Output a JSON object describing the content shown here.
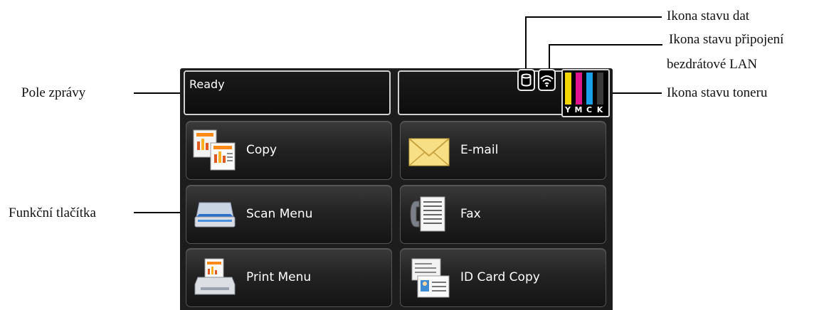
{
  "callouts": {
    "data_status_icon": "Ikona stavu dat",
    "wlan_status_icon_line1": "Ikona stavu připojení",
    "wlan_status_icon_line2": "bezdrátové LAN",
    "toner_status_icon": "Ikona stavu toneru",
    "message_field": "Pole zprávy",
    "function_buttons": "Funkční tlačítka"
  },
  "screen": {
    "message": "Ready",
    "toner": {
      "labels": [
        "Y",
        "M",
        "C",
        "K"
      ],
      "colors": [
        "#f2d400",
        "#e0148c",
        "#1aa0e8",
        "#2a2a2a"
      ]
    },
    "buttons": [
      {
        "label": "Copy",
        "icon": "copy-icon"
      },
      {
        "label": "E-mail",
        "icon": "envelope-icon"
      },
      {
        "label": "Scan Menu",
        "icon": "scanner-icon"
      },
      {
        "label": "Fax",
        "icon": "fax-icon"
      },
      {
        "label": "Print Menu",
        "icon": "printer-icon"
      },
      {
        "label": "ID Card Copy",
        "icon": "id-card-icon"
      }
    ]
  }
}
